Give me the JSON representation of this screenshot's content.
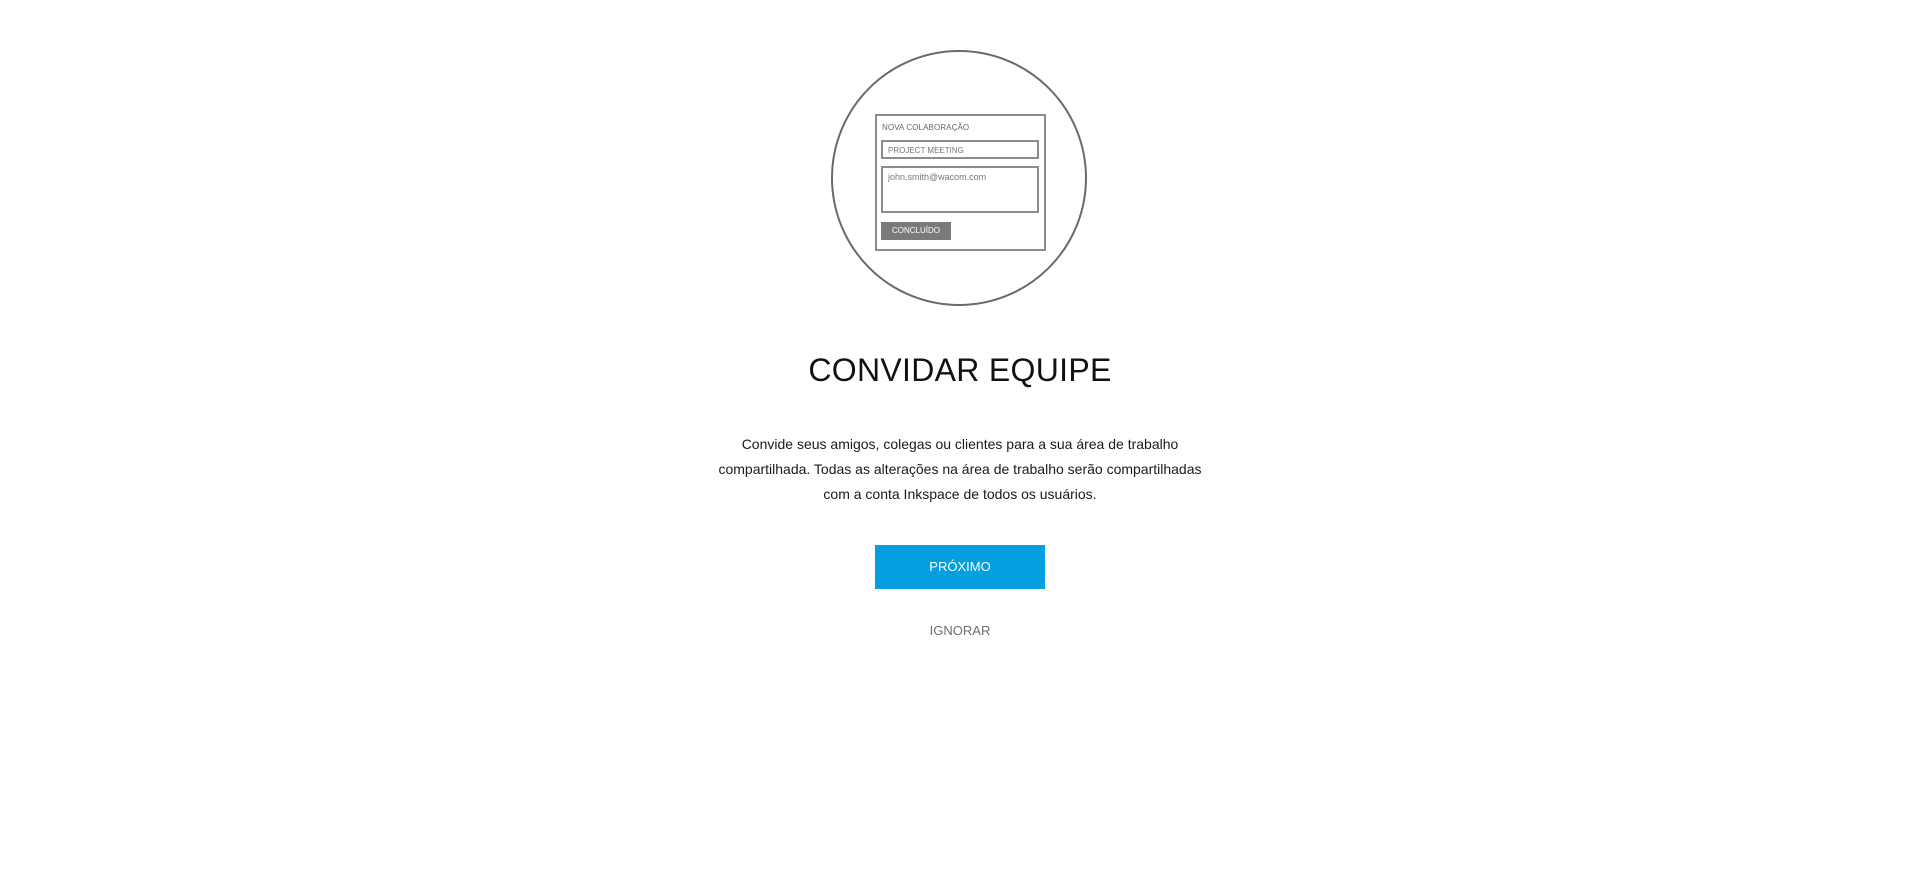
{
  "illustration": {
    "form_title": "NOVA COLABORAÇÃO",
    "project_value": "PROJECT MEETING",
    "email_value": "john.smith@wacom.com",
    "done_label": "CONCLUÍDO"
  },
  "main": {
    "title": "CONVIDAR EQUIPE",
    "description": "Convide seus amigos, colegas ou clientes para a sua área de trabalho compartilhada. Todas as alterações na área de trabalho serão compartilhadas com a conta Inkspace de todos os usuários.",
    "next_label": "PRÓXIMO",
    "skip_label": "IGNORAR"
  },
  "colors": {
    "accent": "#039fe1",
    "circle_stroke": "#6a6a6a",
    "mock_button": "#7a7a7a"
  }
}
